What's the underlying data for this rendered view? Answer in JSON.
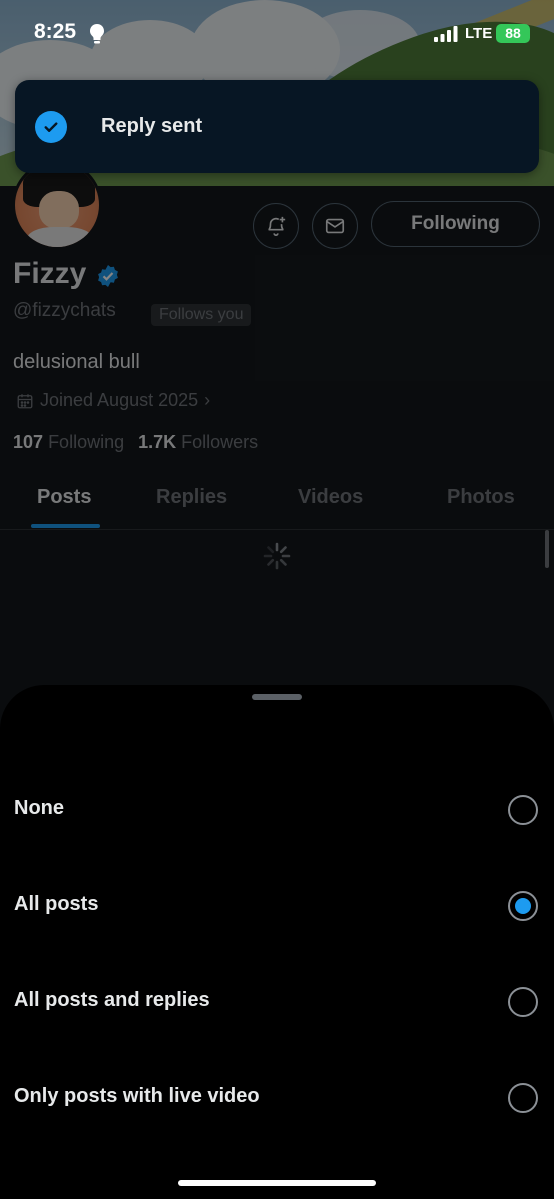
{
  "status_bar": {
    "time": "8:25",
    "network": "LTE",
    "battery": "88"
  },
  "toast": {
    "message": "Reply sent"
  },
  "profile": {
    "name": "Fizzy",
    "handle": "@fizzychats",
    "follows_you_badge": "Follows you",
    "bio": "delusional bull",
    "joined": "Joined August 2025",
    "following_count": "107",
    "following_label": "Following",
    "followers_count": "1.7K",
    "followers_label": "Followers",
    "follow_button_label": "Following",
    "accent_color": "#1d9bf0"
  },
  "tabs": [
    {
      "label": "Posts",
      "active": true
    },
    {
      "label": "Replies",
      "active": false
    },
    {
      "label": "Videos",
      "active": false
    },
    {
      "label": "Photos",
      "active": false
    }
  ],
  "sheet": {
    "options": [
      {
        "label": "None",
        "selected": false
      },
      {
        "label": "All posts",
        "selected": true
      },
      {
        "label": "All posts and replies",
        "selected": false
      },
      {
        "label": "Only posts with live video",
        "selected": false
      }
    ]
  },
  "icons": {
    "notification_bell": "bell-plus-icon",
    "message": "envelope-icon",
    "verified": "verified-badge-icon",
    "calendar": "calendar-icon",
    "check": "check-icon"
  }
}
